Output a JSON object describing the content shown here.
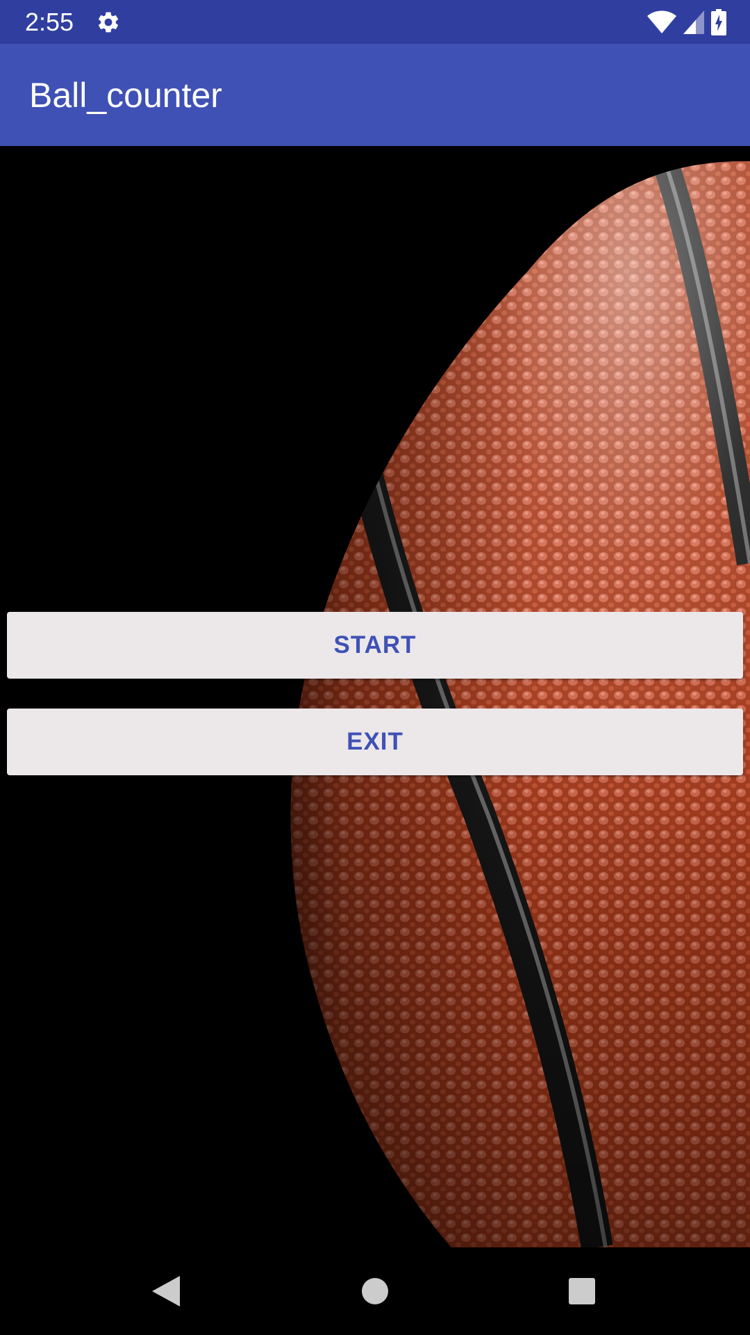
{
  "status_bar": {
    "time": "2:55",
    "color": "#303F9F",
    "icons": [
      "gear-icon",
      "wifi-icon",
      "cell-signal-icon",
      "battery-icon"
    ]
  },
  "toolbar": {
    "title": "Ball_counter",
    "color": "#3F51B5"
  },
  "background": {
    "image": "basketball-close-up",
    "colors": [
      "#000000",
      "#B5401F"
    ]
  },
  "buttons": {
    "start_label": "START",
    "exit_label": "EXIT",
    "text_color": "#3F51B5",
    "background_color": "#ECE8EA"
  },
  "nav_bar": {
    "icons": [
      "back-icon",
      "home-icon",
      "recents-icon"
    ]
  }
}
